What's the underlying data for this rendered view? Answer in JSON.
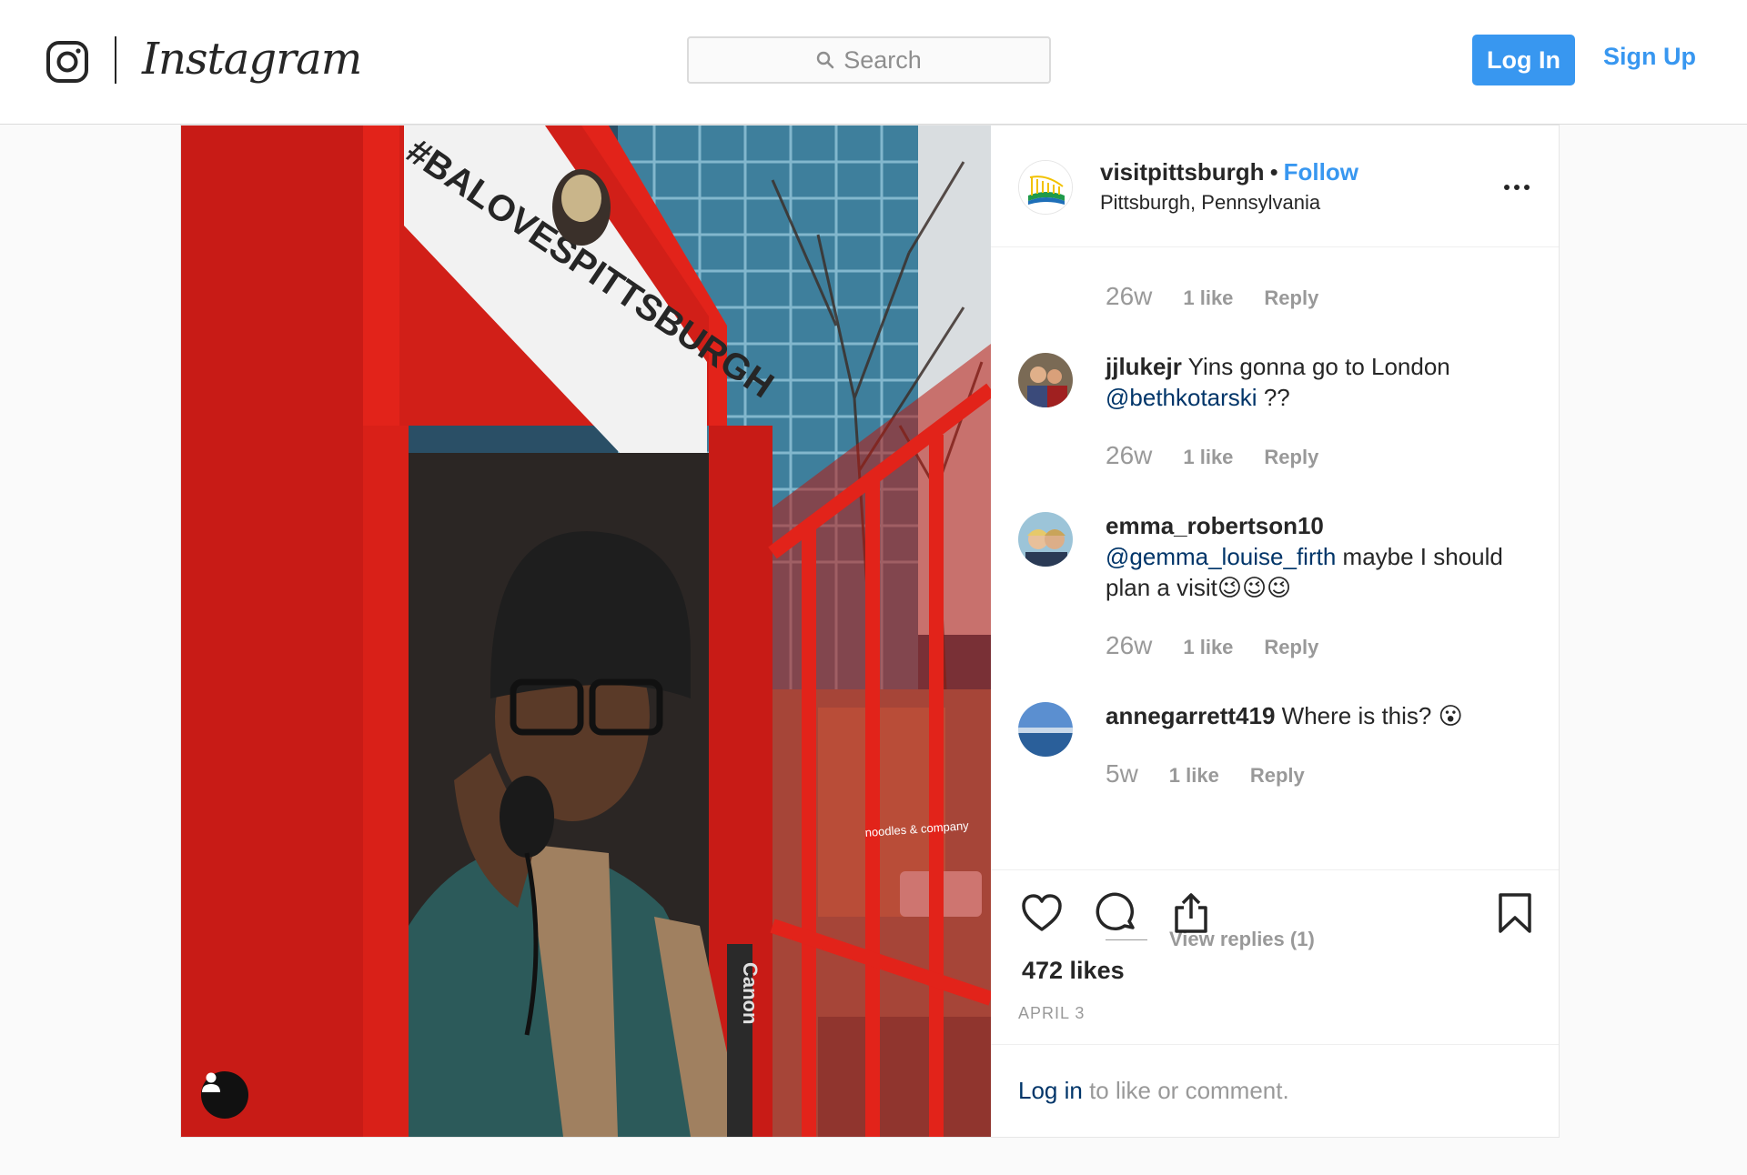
{
  "header": {
    "brand": "Instagram",
    "search_placeholder": "Search",
    "login_label": "Log In",
    "signup_label": "Sign Up"
  },
  "post": {
    "owner": "visitpittsburgh",
    "separator": "•",
    "follow_label": "Follow",
    "location": "Pittsburgh, Pennsylvania",
    "more_icon": "more-horizontal-icon",
    "photo_sign_text": "#BALOVESPITTSBURGH",
    "photo_strap_text": "Canon",
    "photo_storefront_text": "noodles & company",
    "comments": [
      {
        "meta": {
          "time": "26w",
          "likes": "1 like",
          "reply": "Reply"
        }
      },
      {
        "user": "jjlukejr",
        "text": "Yins gonna go to London",
        "mention": "@bethkotarski",
        "text_after": "??",
        "meta": {
          "time": "26w",
          "likes": "1 like",
          "reply": "Reply"
        }
      },
      {
        "user": "emma_robertson10",
        "mention": "@gemma_louise_firth",
        "text_after": "maybe I should plan a visit😉😉😉",
        "meta": {
          "time": "26w",
          "likes": "1 like",
          "reply": "Reply"
        }
      },
      {
        "user": "annegarrett419",
        "text": "Where is this? 😮",
        "meta": {
          "time": "5w",
          "likes": "1 like",
          "reply": "Reply"
        },
        "view_replies": "View replies (1)"
      }
    ],
    "likes_count": "472 likes",
    "date": "APRIL 3",
    "footer": {
      "login_link": "Log in",
      "rest": "to like or comment."
    }
  },
  "colors": {
    "accent": "#3897f0",
    "mention": "#003569",
    "muted": "#999999",
    "phonebox_red": "#e2231a"
  }
}
